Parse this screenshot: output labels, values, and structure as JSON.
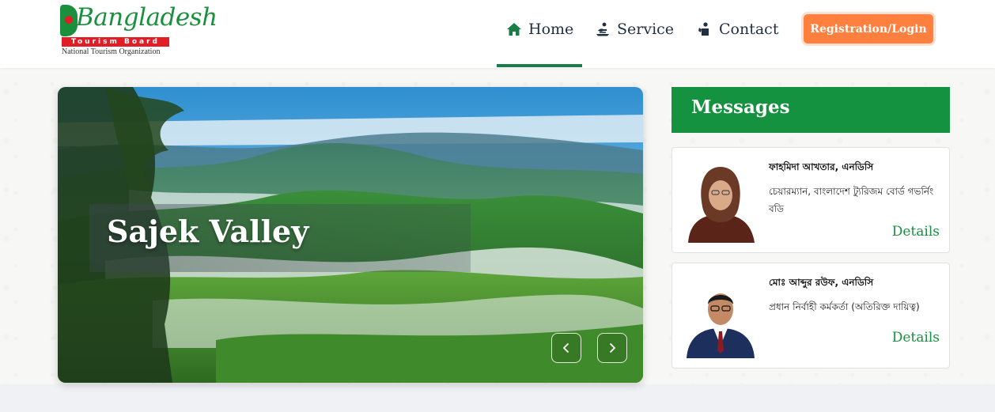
{
  "header": {
    "logo": {
      "wordmark": "Bangladesh",
      "band": "Tourism Board",
      "tagline": "National Tourism Organization"
    },
    "nav": [
      {
        "label": "Home",
        "icon": "home-icon",
        "active": true
      },
      {
        "label": "Service",
        "icon": "service-icon"
      },
      {
        "label": "Contact",
        "icon": "contact-icon"
      }
    ],
    "cta_label": "Registration/Login"
  },
  "hero": {
    "slide_title": "Sajek Valley",
    "prev_icon": "chevron-left-icon",
    "next_icon": "chevron-right-icon"
  },
  "messages": {
    "title": "Messages",
    "items": [
      {
        "name": "ফাহমিদা আখতার, এনডিসি",
        "role": "চেয়ারম্যান, বাংলাদেশ ট্যুরিজম বোর্ড গভর্নিং বডি",
        "link": "Details"
      },
      {
        "name": "মোঃ আব্দুর রউফ, এনডিসি",
        "role": "প্রধান নির্বাহী কর্মকর্তা (অতিরিক্ত দায়িত্ব)",
        "link": "Details"
      }
    ]
  },
  "colors": {
    "brand_green": "#14923f",
    "brand_red": "#e11d25",
    "cta_orange": "#ff7f3f",
    "nav_text": "#1f3044"
  }
}
